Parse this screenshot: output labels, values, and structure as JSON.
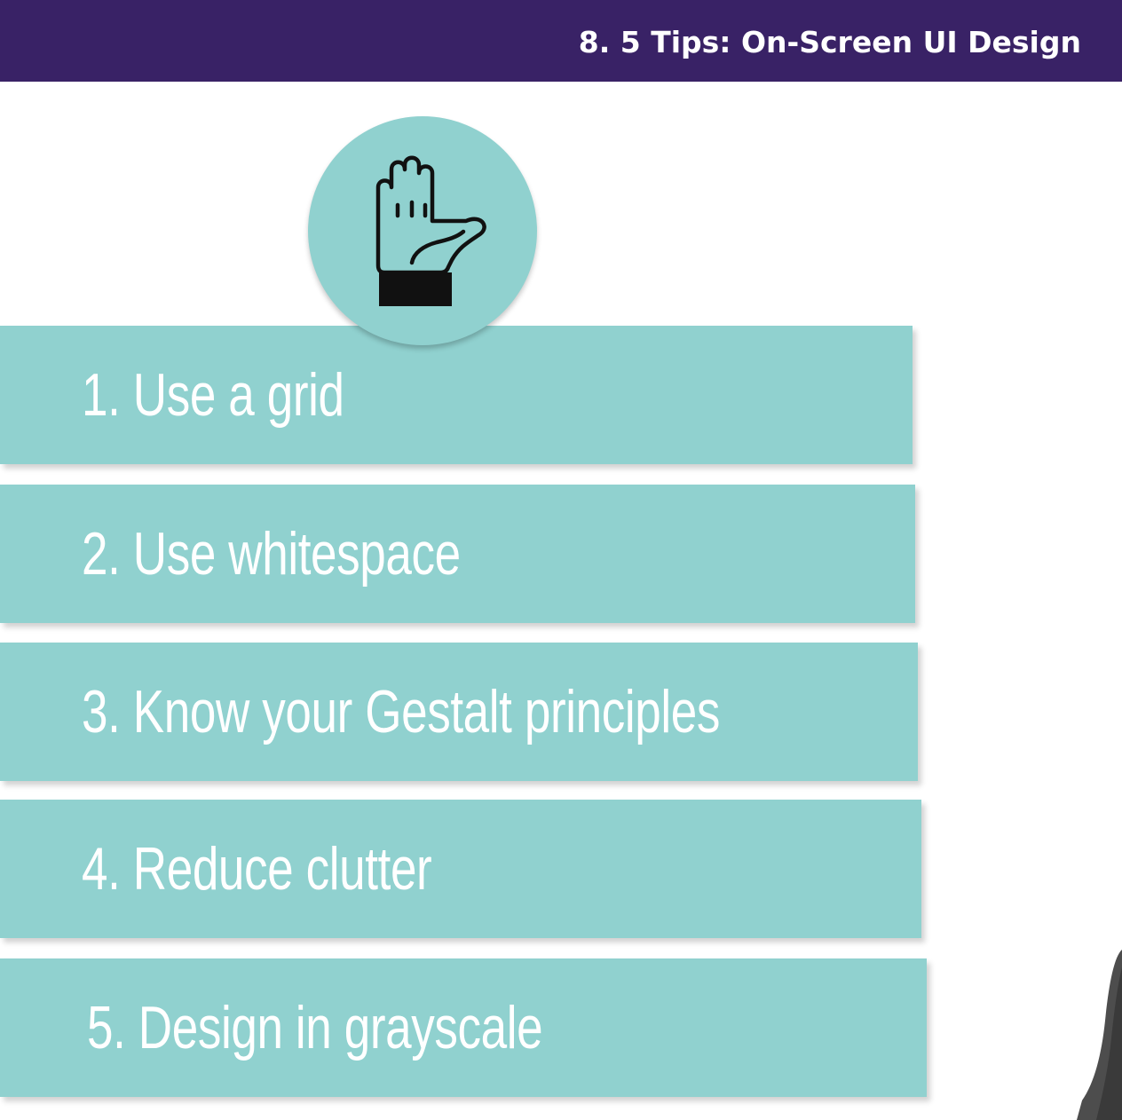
{
  "header": {
    "title": "8. 5 Tips: On-Screen UI Design",
    "background_color": "#392266"
  },
  "icon": {
    "name": "raised-hand-icon",
    "circle_color": "#90d1cf"
  },
  "tips": [
    {
      "label": "1. Use a grid"
    },
    {
      "label": "2. Use whitespace"
    },
    {
      "label": "3. Know your Gestalt principles"
    },
    {
      "label": "4. Reduce clutter"
    },
    {
      "label": "5. Design in grayscale"
    }
  ],
  "colors": {
    "tip_background": "#90d1cf",
    "tip_text": "#ffffff"
  }
}
